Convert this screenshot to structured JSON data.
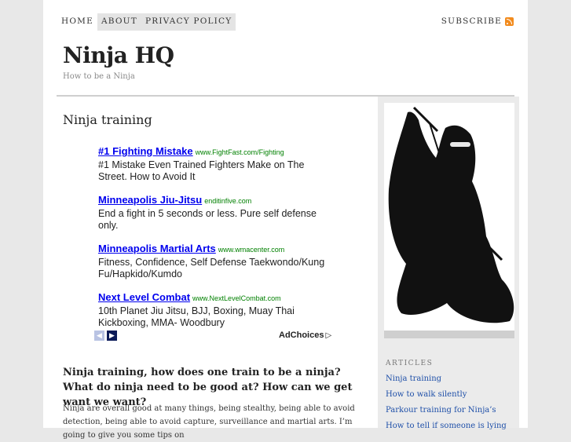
{
  "nav": {
    "items": [
      "Home",
      "About",
      "Privacy Policy"
    ],
    "subscribe": "Subscribe"
  },
  "site": {
    "title": "Ninja HQ",
    "tagline": "How to be a Ninja"
  },
  "post": {
    "title": "Ninja training",
    "heading": "Ninja training, how does one train to be a ninja? What do ninja need to be good at? How can we get want we want?",
    "body": "Ninja are overall good at many things, being stealthy, being able to avoid detection, being able to avoid capture, surveillance and martial arts. I’m going to give you some tips on"
  },
  "ads": [
    {
      "title": "#1 Fighting Mistake",
      "url": "www.FightFast.com/Fighting",
      "desc": "#1 Mistake Even Trained Fighters Make on The Street. How to Avoid It"
    },
    {
      "title": "Minneapolis Jiu-Jitsu",
      "url": "enditinfive.com",
      "desc": "End a fight in 5 seconds or less. Pure self defense only."
    },
    {
      "title": "Minneapolis Martial Arts",
      "url": "www.wmacenter.com",
      "desc": "Fitness, Confidence, Self Defense Taekwondo/Kung Fu/Hapkido/Kumdo"
    },
    {
      "title": "Next Level Combat",
      "url": "www.NextLevelCombat.com",
      "desc": "10th Planet Jiu Jitsu, BJJ, Boxing, Muay Thai Kickboxing, MMA- Woodbury"
    }
  ],
  "adchoices": "AdChoices",
  "sidebar": {
    "widget_title": "Articles",
    "articles": [
      "Ninja training",
      "How to walk silently",
      "Parkour training for Ninja’s",
      "How to tell if someone is lying"
    ]
  }
}
